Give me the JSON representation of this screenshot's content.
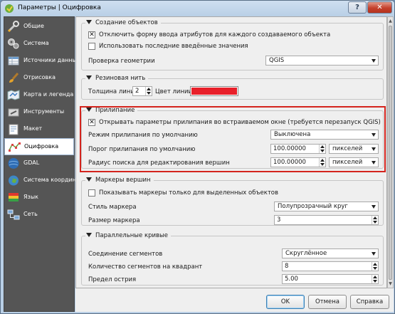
{
  "window": {
    "title": "Параметры | Оцифровка",
    "help_label": "?",
    "close_label": "✕"
  },
  "sidebar": {
    "items": [
      {
        "label": "Общие",
        "icon": "wrench-icon"
      },
      {
        "label": "Система",
        "icon": "gears-icon"
      },
      {
        "label": "Источники данных",
        "icon": "table-icon"
      },
      {
        "label": "Отрисовка",
        "icon": "brush-icon"
      },
      {
        "label": "Карта и легенда",
        "icon": "map-icon"
      },
      {
        "label": "Инструменты",
        "icon": "tools-icon"
      },
      {
        "label": "Макет",
        "icon": "layout-icon"
      },
      {
        "label": "Оцифровка",
        "icon": "digitizing-icon",
        "selected": true
      },
      {
        "label": "GDAL",
        "icon": "gdal-icon"
      },
      {
        "label": "Система координат",
        "icon": "globe-icon"
      },
      {
        "label": "Язык",
        "icon": "flag-icon"
      },
      {
        "label": "Сеть",
        "icon": "network-icon"
      }
    ]
  },
  "feature_creation": {
    "title": "Создание объектов",
    "suppress_form_label": "Отключить форму ввода атрибутов для каждого создаваемого объекта",
    "suppress_form_checked": true,
    "reuse_values_label": "Использовать последние введённые значения",
    "reuse_values_checked": false,
    "geometry_check_label": "Проверка геометрии",
    "geometry_check_value": "QGIS"
  },
  "rubberband": {
    "title": "Резиновая нить",
    "line_width_label": "Толщина линии",
    "line_width_value": "2",
    "line_color_label": "Цвет линии",
    "line_color": "#e8202a"
  },
  "snapping": {
    "title": "Прилипание",
    "open_dock_label": "Открывать параметры прилипания во встраиваемом окне (требуется перезапуск QGIS)",
    "open_dock_checked": true,
    "default_mode_label": "Режим прилипания по умолчанию",
    "default_mode_value": "Выключена",
    "default_tolerance_label": "Порог прилипания по умолчанию",
    "default_tolerance_value": "100.00000",
    "default_tolerance_unit": "пикселей",
    "search_radius_label": "Радиус поиска для редактирования вершин",
    "search_radius_value": "100.00000",
    "search_radius_unit": "пикселей",
    "highlight_color": "#d4241d"
  },
  "vertex_markers": {
    "title": "Маркеры вершин",
    "selected_only_label": "Показывать маркеры только для выделенных объектов",
    "selected_only_checked": false,
    "marker_style_label": "Стиль маркера",
    "marker_style_value": "Полупрозрачный круг",
    "marker_size_label": "Размер маркера",
    "marker_size_value": "3"
  },
  "offset_curves": {
    "title": "Параллельные кривые",
    "join_style_label": "Соединение сегментов",
    "join_style_value": "Скруглённое",
    "quadrant_segments_label": "Количество сегментов на квадрант",
    "quadrant_segments_value": "8",
    "miter_limit_label": "Предел острия",
    "miter_limit_value": "5.00"
  },
  "buttons": {
    "ok": "OK",
    "cancel": "Отмена",
    "help": "Справка"
  }
}
